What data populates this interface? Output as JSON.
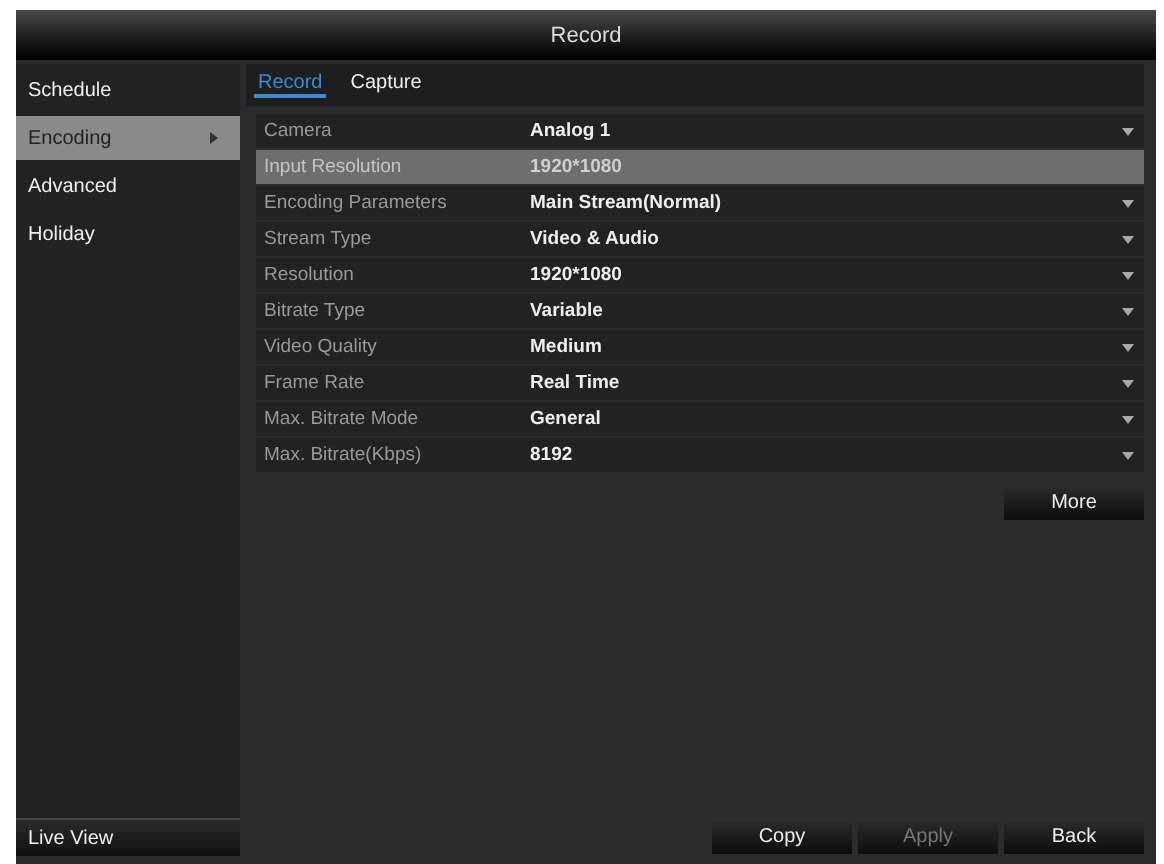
{
  "window": {
    "title": "Record"
  },
  "sidebar": {
    "items": [
      {
        "label": "Schedule",
        "selected": false,
        "expandable": false
      },
      {
        "label": "Encoding",
        "selected": true,
        "expandable": true
      },
      {
        "label": "Advanced",
        "selected": false,
        "expandable": false
      },
      {
        "label": "Holiday",
        "selected": false,
        "expandable": false
      }
    ],
    "footer": "Live View"
  },
  "tabs": [
    {
      "label": "Record",
      "selected": true
    },
    {
      "label": "Capture",
      "selected": false
    }
  ],
  "settings": [
    {
      "label": "Camera",
      "value": "Analog 1",
      "disabled": false
    },
    {
      "label": "Input Resolution",
      "value": "1920*1080",
      "disabled": true
    },
    {
      "label": "Encoding Parameters",
      "value": "Main Stream(Normal)",
      "disabled": false
    },
    {
      "label": "Stream Type",
      "value": "Video & Audio",
      "disabled": false
    },
    {
      "label": "Resolution",
      "value": "1920*1080",
      "disabled": false
    },
    {
      "label": "Bitrate Type",
      "value": "Variable",
      "disabled": false
    },
    {
      "label": "Video Quality",
      "value": "Medium",
      "disabled": false
    },
    {
      "label": "Frame Rate",
      "value": "Real Time",
      "disabled": false
    },
    {
      "label": "Max. Bitrate Mode",
      "value": "General",
      "disabled": false
    },
    {
      "label": "Max. Bitrate(Kbps)",
      "value": "8192",
      "disabled": false
    }
  ],
  "more_button": "More",
  "buttons": [
    {
      "label": "Copy",
      "disabled": false
    },
    {
      "label": "Apply",
      "disabled": true
    },
    {
      "label": "Back",
      "disabled": false
    }
  ]
}
